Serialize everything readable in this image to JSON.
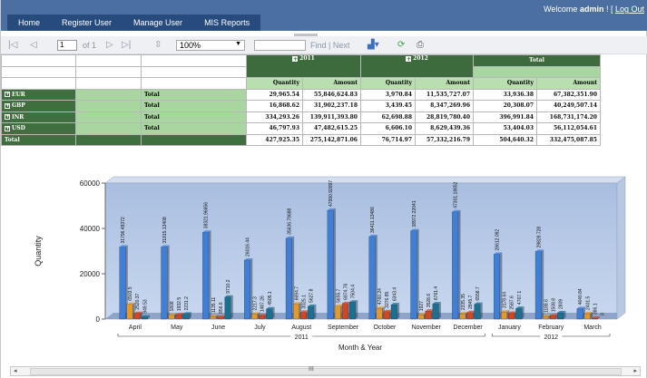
{
  "nav": {
    "items": [
      "Home",
      "Register User",
      "Manage User",
      "MIS Reports"
    ],
    "welcome_prefix": "Welcome ",
    "user": "admin",
    "welcome_sep": " ! [ ",
    "logout": "Log Out"
  },
  "toolbar": {
    "first_icon": "first-page-icon",
    "prev_icon": "prev-page-icon",
    "page": "1",
    "of_pages": "of 1",
    "next_icon": "next-page-icon",
    "last_icon": "last-page-icon",
    "zoom": "100%",
    "find_label": "Find",
    "sep": "|",
    "next_label": "Next",
    "export_icon": "export-icon",
    "refresh_icon": "refresh-icon",
    "print_icon": "print-icon"
  },
  "pivot": {
    "years": [
      "2011",
      "2012"
    ],
    "total_header": "Total",
    "col_headers": [
      "Quantity",
      "Amount"
    ],
    "rows": [
      {
        "label": "EUR",
        "sub": "Total",
        "cells": [
          "29,965.54",
          "55,846,624.83",
          "3,970.84",
          "11,535,727.07",
          "33,936.38",
          "67,382,351.90"
        ]
      },
      {
        "label": "GBP",
        "sub": "Total",
        "cells": [
          "16,868.62",
          "31,902,237.18",
          "3,439.45",
          "8,347,269.96",
          "20,308.07",
          "40,249,507.14"
        ]
      },
      {
        "label": "INR",
        "sub": "Total",
        "cells": [
          "334,293.26",
          "139,911,393.80",
          "62,698.88",
          "28,819,780.40",
          "396,991.84",
          "168,731,174.20"
        ]
      },
      {
        "label": "USD",
        "sub": "Total",
        "cells": [
          "46,797.93",
          "47,482,615.25",
          "6,606.10",
          "8,629,439.36",
          "53,404.03",
          "56,112,054.61"
        ]
      }
    ],
    "total_row": {
      "label": "Total",
      "cells": [
        "427,925.35",
        "275,142,871.06",
        "76,714.97",
        "57,332,216.79",
        "504,640.32",
        "332,475,087.85"
      ]
    }
  },
  "chart_data": {
    "type": "bar",
    "categories": [
      "April",
      "May",
      "June",
      "July",
      "August",
      "September",
      "October",
      "November",
      "December",
      "January",
      "February",
      "March"
    ],
    "groups": [
      {
        "label": "2011",
        "from": 0,
        "to": 8
      },
      {
        "label": "2012",
        "from": 9,
        "to": 11
      }
    ],
    "xlabel": "Month & Year",
    "ylabel": "Quantity",
    "ylim": [
      0,
      60000
    ],
    "yticks": [
      0,
      20000,
      40000,
      60000
    ],
    "series_colors": [
      "#3f7fd6",
      "#e39a2c",
      "#d4471e",
      "#1b6f8f"
    ],
    "series": [
      {
        "values": [
          31796.48372,
          31815.13408,
          38321.96656,
          26016.44,
          35636.79688,
          47990.92897,
          36411.13486,
          38972.22041,
          47301.18652,
          28612.092,
          29828.728,
          4640.84
        ]
      },
      {
        "values": [
          6503.5,
          1808,
          1135.11,
          2217.3,
          6694.7,
          5655.7,
          4760.24,
          1927,
          2335.35,
          3178.64,
          1188.6,
          2401.5
        ]
      },
      {
        "values": [
          2520.37,
          1932.5,
          856.6,
          1487.26,
          3025.1,
          6874.76,
          3276.85,
          3528.6,
          2845.7,
          2587.6,
          1508.8,
          386.1
        ]
      },
      {
        "values": [
          949.53,
          2231.2,
          9710.2,
          4505.1,
          5627.8,
          7504.4,
          6343.4,
          6761.4,
          6558.7,
          4767.1,
          2809,
          0
        ]
      }
    ],
    "data_labels": {
      "April": [
        "31796.48372",
        "6503.5",
        "2520.37",
        "949.53"
      ],
      "May": [
        "31815.13408",
        "1808",
        "1932.5",
        "2231.2"
      ],
      "June": [
        "38321.96656",
        "1135.11",
        "856.6",
        "9710.2"
      ],
      "July": [
        "26016.44",
        "2217.3",
        "1487.26",
        "4505.1"
      ],
      "August": [
        "35636.79688",
        "6694.7",
        "3025.1",
        "5627.8"
      ],
      "September": [
        "47990.92897",
        "5655.7",
        "6874.76",
        "7504.4"
      ],
      "October": [
        "36411.13486",
        "4760.24",
        "3276.85",
        "6343.4"
      ],
      "November": [
        "38972.22041",
        "1927",
        "3528.6",
        "6761.4"
      ],
      "December": [
        "47301.18652",
        "2335.35",
        "2845.7",
        "6558.7"
      ],
      "January": [
        "28612.092",
        "3178.64",
        "2587.6",
        "4767.1"
      ],
      "February": [
        "29828.728",
        "1188.6",
        "1508.8",
        "2809"
      ],
      "March": [
        "4640.84",
        "2401.5",
        "386.1",
        "0"
      ]
    }
  },
  "scrollbar": {
    "grip": "III"
  }
}
